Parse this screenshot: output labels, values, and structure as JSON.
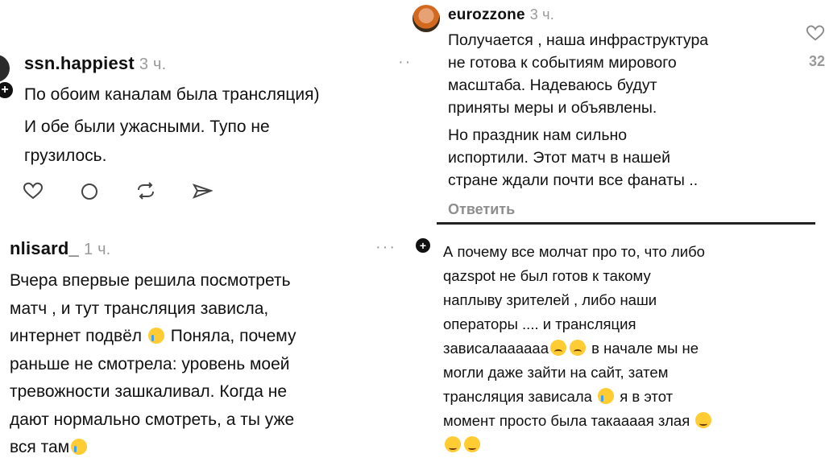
{
  "comment_tl": {
    "username": "ssn.happiest",
    "time": "3 ч.",
    "more": "··",
    "lines": [
      "По обоим каналам была трансляция)",
      "И обе были ужасными. Тупо не",
      "грузилось."
    ],
    "actions": [
      "heart-icon",
      "comment-icon",
      "repost-icon",
      "share-icon"
    ]
  },
  "comment_tr": {
    "username": "eurozzone",
    "time": "3 ч.",
    "like_count": "32",
    "paragraph1": [
      "Получается , наша инфраструктура",
      "не готова к событиям мирового",
      "масштаба. Надеваюсь будут",
      "приняты меры и объявлены."
    ],
    "paragraph2": [
      "Но праздник нам сильно",
      "испортили. Этот матч в нашей",
      "стране ждали почти все фанаты .."
    ],
    "reply_label": "Ответить"
  },
  "comment_bl": {
    "username": "nlisard_",
    "time": "1 ч.",
    "more": "···",
    "line1": "Вчера впервые решила посмотреть",
    "line2": "матч , и тут трансляция зависла,",
    "line3a": "интернет подвёл",
    "line3b": "Поняла, почему",
    "line4": "раньше не смотрела: уровень моей",
    "line5": "тревожности зашкаливал. Когда не",
    "line6": "дают нормально смотреть, а ты уже",
    "line7": "вся там"
  },
  "comment_br": {
    "line1": "А почему все молчат про то, что либо",
    "line2": "qazspot не был готов к такому",
    "line3": "наплыву зрителей , либо наши",
    "line4": "операторы .... и трансляция",
    "line5a": "зависалаааааа",
    "line5b": "в начале мы не",
    "line6": "могли даже зайти на сайт, затем",
    "line7a": "трансляция зависала",
    "line7b": "я в этот",
    "line8": "момент просто была такаааая злая"
  },
  "colors": {
    "text": "#111111",
    "muted": "#9a9a9a",
    "background": "#ffffff",
    "emoji": "#ffcc33"
  }
}
